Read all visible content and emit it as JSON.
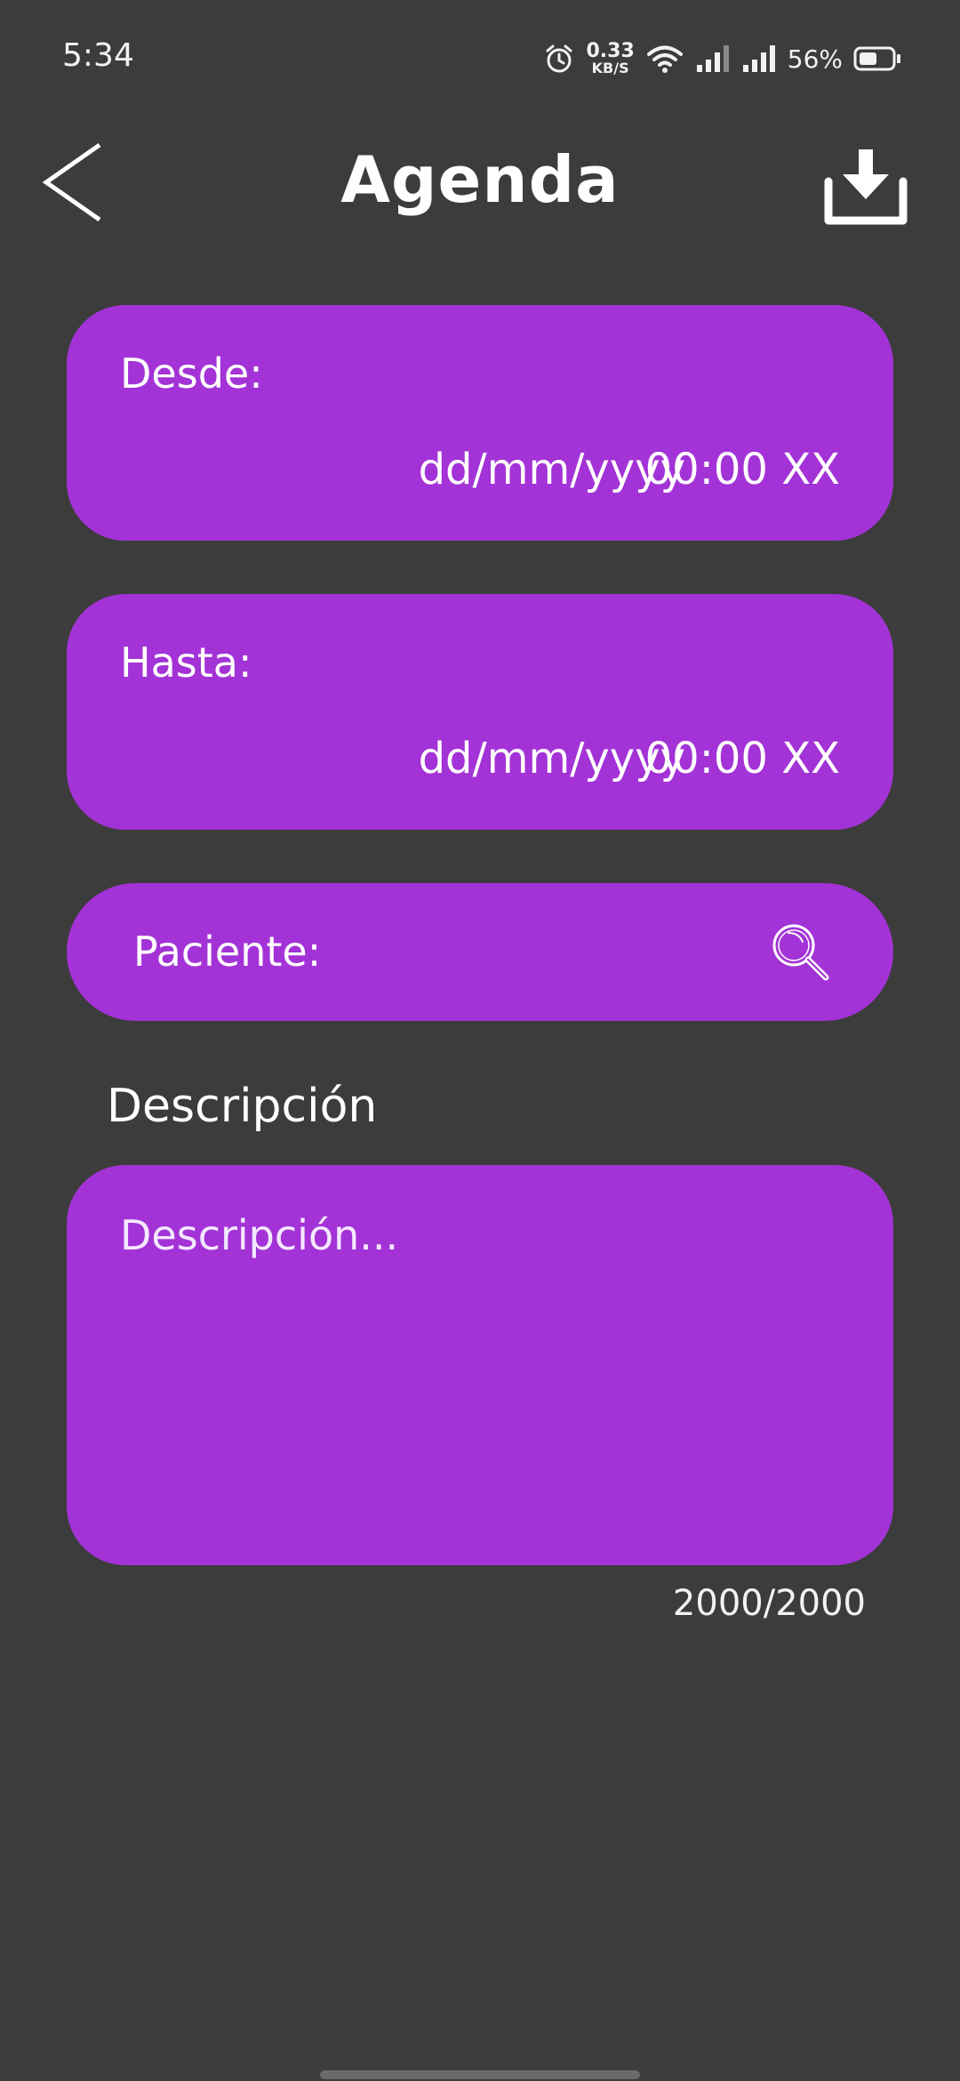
{
  "status_bar": {
    "time": "5:34",
    "net_speed_value": "0.33",
    "net_speed_unit": "KB/S",
    "battery_percent": "56%",
    "battery_level": 0.56
  },
  "header": {
    "title": "Agenda",
    "back_icon": "chevron-left-icon",
    "download_icon": "download-tray-icon"
  },
  "from": {
    "label": "Desde:",
    "date_placeholder": "dd/mm/yyyy",
    "time_placeholder": "00:00 XX"
  },
  "to": {
    "label": "Hasta:",
    "date_placeholder": "dd/mm/yyyy",
    "time_placeholder": "00:00 XX"
  },
  "patient": {
    "label": "Paciente:",
    "search_icon": "search-icon"
  },
  "description": {
    "heading": "Descripción",
    "placeholder": "Descripción...",
    "counter": "2000/2000"
  },
  "colors": {
    "background": "#3c3c3c",
    "accent": "#a333d6",
    "text": "#ffffff"
  }
}
